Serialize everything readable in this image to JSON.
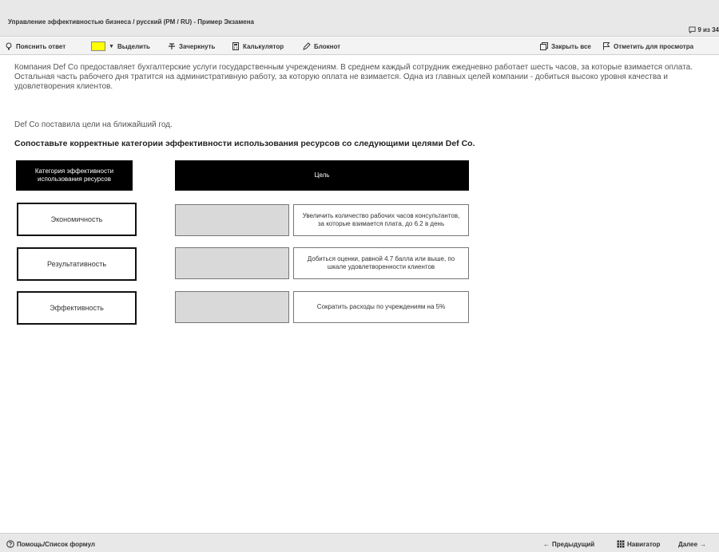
{
  "window": {
    "title": "Управление эффективностью бизнеса / русский (PM / RU) - Пример Экзамена",
    "page_counter": "9 из 34"
  },
  "toolbar": {
    "explain_answer": "Пояснить ответ",
    "highlight": "Выделить",
    "highlight_color": "#ffff00",
    "strikethrough": "Зачеркнуть",
    "calculator": "Калькулятор",
    "notepad": "Блокнот",
    "close_all": "Закрыть все",
    "flag_for_review": "Отметить для просмотра"
  },
  "question": {
    "scenario": "Компания Def Co предоставляет бухгалтерские услуги государственным учреждениям. В среднем каждый сотрудник ежедневно работает шесть часов, за которые взимается оплата. Остальная часть рабочего дня тратится на административную работу, за которую оплата не взимается. Одна из главных целей компании - добиться высоко уровня качества и удовлетворения клиентов.",
    "intro": "Def Co поставила цели на ближайший год.",
    "instruction": "Сопоставьте корректные категории эффективности использования ресурсов со следующими целями Def Co.",
    "column_category_header": "Категория эффективности использования ресурсов",
    "column_goal_header": "Цель",
    "categories": [
      "Экономичность",
      "Результативность",
      "Эффективность"
    ],
    "goals": [
      "Увеличить количество рабочих часов консультантов, за которые взимается плата, до 6.2 в день",
      "Добиться оценки, равной 4.7 балла или выше, по шкале удовлетворенности клиентов",
      "Сократить расходы по учреждениям на 5%"
    ]
  },
  "footer": {
    "help": "Помощь/Список формул",
    "previous": "Предыдущий",
    "navigator": "Навигатор",
    "next": "Далее"
  }
}
